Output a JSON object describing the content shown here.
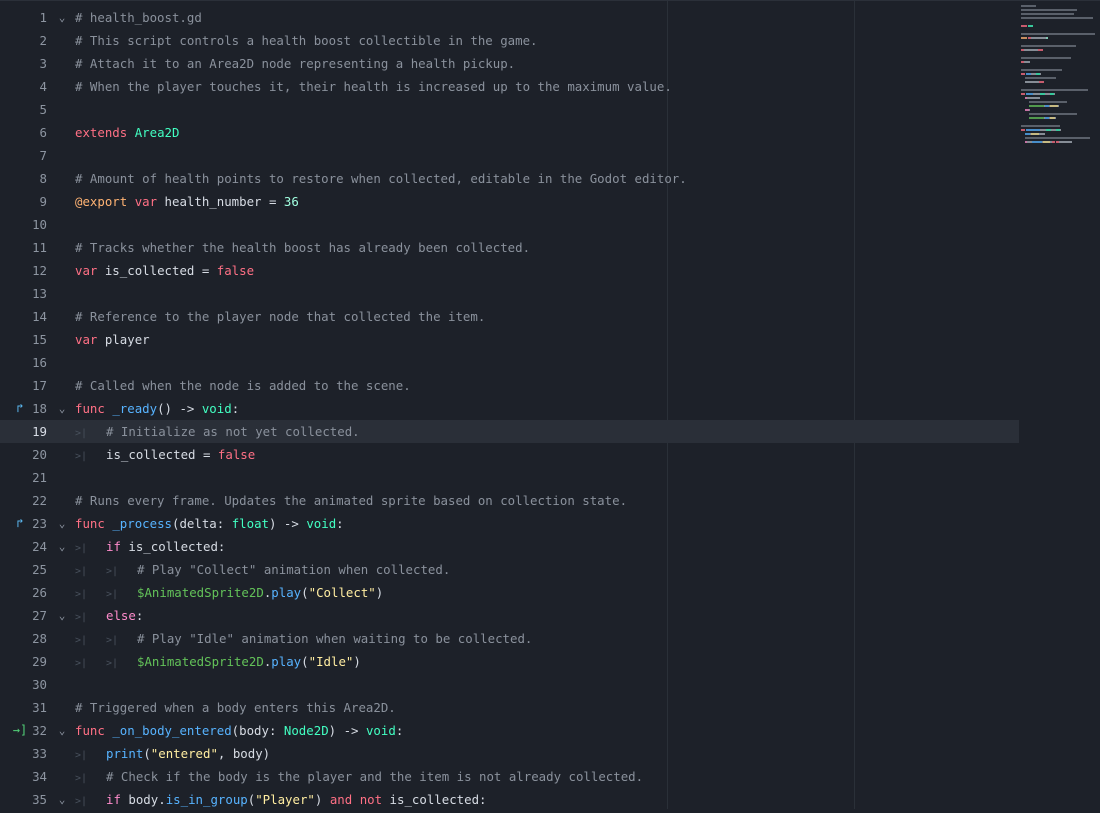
{
  "editor": {
    "current_line": 19,
    "colors": {
      "background": "#1d2129",
      "comment": "#8a919c",
      "keyword": "#ff7085",
      "type": "#42ffc2",
      "function": "#57b3ff",
      "string": "#ffeda1",
      "number": "#a1ffe0",
      "annotation": "#ffb373",
      "node_path": "#63c259"
    },
    "lines": [
      {
        "n": "1",
        "fold": true,
        "tokens": [
          {
            "t": "# health_boost.gd",
            "c": "cm"
          }
        ]
      },
      {
        "n": "2",
        "tokens": [
          {
            "t": "# This script controls a health boost collectible in the game.",
            "c": "cm"
          }
        ]
      },
      {
        "n": "3",
        "tokens": [
          {
            "t": "# Attach it to an Area2D node representing a health pickup.",
            "c": "cm"
          }
        ]
      },
      {
        "n": "4",
        "tokens": [
          {
            "t": "# When the player touches it, their health is increased up to the maximum value.",
            "c": "cm"
          }
        ]
      },
      {
        "n": "5",
        "tokens": []
      },
      {
        "n": "6",
        "tokens": [
          {
            "t": "extends",
            "c": "kw"
          },
          {
            "t": " "
          },
          {
            "t": "Area2D",
            "c": "ty"
          }
        ]
      },
      {
        "n": "7",
        "tokens": []
      },
      {
        "n": "8",
        "tokens": [
          {
            "t": "# Amount of health points to restore when collected, editable in the Godot editor.",
            "c": "cm"
          }
        ]
      },
      {
        "n": "9",
        "tokens": [
          {
            "t": "@export",
            "c": "ann"
          },
          {
            "t": " "
          },
          {
            "t": "var",
            "c": "kw"
          },
          {
            "t": " health_number = "
          },
          {
            "t": "36",
            "c": "num"
          }
        ]
      },
      {
        "n": "10",
        "tokens": []
      },
      {
        "n": "11",
        "tokens": [
          {
            "t": "# Tracks whether the health boost has already been collected.",
            "c": "cm"
          }
        ]
      },
      {
        "n": "12",
        "tokens": [
          {
            "t": "var",
            "c": "kw"
          },
          {
            "t": " is_collected = "
          },
          {
            "t": "false",
            "c": "kw"
          }
        ]
      },
      {
        "n": "13",
        "tokens": []
      },
      {
        "n": "14",
        "tokens": [
          {
            "t": "# Reference to the player node that collected the item.",
            "c": "cm"
          }
        ]
      },
      {
        "n": "15",
        "tokens": [
          {
            "t": "var",
            "c": "kw"
          },
          {
            "t": " player"
          }
        ]
      },
      {
        "n": "16",
        "tokens": []
      },
      {
        "n": "17",
        "tokens": [
          {
            "t": "# Called when the node is added to the scene.",
            "c": "cm"
          }
        ]
      },
      {
        "n": "18",
        "fold": true,
        "icon": "override",
        "tokens": [
          {
            "t": "func",
            "c": "kw"
          },
          {
            "t": " "
          },
          {
            "t": "_ready",
            "c": "fn"
          },
          {
            "t": "() -> "
          },
          {
            "t": "void",
            "c": "ty"
          },
          {
            "t": ":"
          }
        ]
      },
      {
        "n": "19",
        "indent": 1,
        "tokens": [
          {
            "t": "# Initialize as not yet collected.",
            "c": "cm"
          }
        ]
      },
      {
        "n": "20",
        "indent": 1,
        "tokens": [
          {
            "t": "is_collected = "
          },
          {
            "t": "false",
            "c": "kw"
          }
        ]
      },
      {
        "n": "21",
        "tokens": []
      },
      {
        "n": "22",
        "tokens": [
          {
            "t": "# Runs every frame. Updates the animated sprite based on collection state.",
            "c": "cm"
          }
        ]
      },
      {
        "n": "23",
        "fold": true,
        "icon": "override",
        "tokens": [
          {
            "t": "func",
            "c": "kw"
          },
          {
            "t": " "
          },
          {
            "t": "_process",
            "c": "fn"
          },
          {
            "t": "(delta: "
          },
          {
            "t": "float",
            "c": "ty"
          },
          {
            "t": ") -> "
          },
          {
            "t": "void",
            "c": "ty"
          },
          {
            "t": ":"
          }
        ]
      },
      {
        "n": "24",
        "fold": true,
        "indent": 1,
        "tokens": [
          {
            "t": "if",
            "c": "dk"
          },
          {
            "t": " is_collected:"
          }
        ]
      },
      {
        "n": "25",
        "indent": 2,
        "tokens": [
          {
            "t": "# Play \"Collect\" animation when collected.",
            "c": "cm"
          }
        ]
      },
      {
        "n": "26",
        "indent": 2,
        "tokens": [
          {
            "t": "$AnimatedSprite2D",
            "c": "node"
          },
          {
            "t": "."
          },
          {
            "t": "play",
            "c": "fn"
          },
          {
            "t": "("
          },
          {
            "t": "\"Collect\"",
            "c": "str"
          },
          {
            "t": ")"
          }
        ]
      },
      {
        "n": "27",
        "fold": true,
        "indent": 1,
        "tokens": [
          {
            "t": "else",
            "c": "dk"
          },
          {
            "t": ":"
          }
        ]
      },
      {
        "n": "28",
        "indent": 2,
        "tokens": [
          {
            "t": "# Play \"Idle\" animation when waiting to be collected.",
            "c": "cm"
          }
        ]
      },
      {
        "n": "29",
        "indent": 2,
        "tokens": [
          {
            "t": "$AnimatedSprite2D",
            "c": "node"
          },
          {
            "t": "."
          },
          {
            "t": "play",
            "c": "fn"
          },
          {
            "t": "("
          },
          {
            "t": "\"Idle\"",
            "c": "str"
          },
          {
            "t": ")"
          }
        ]
      },
      {
        "n": "30",
        "tokens": []
      },
      {
        "n": "31",
        "tokens": [
          {
            "t": "# Triggered when a body enters this Area2D.",
            "c": "cm"
          }
        ]
      },
      {
        "n": "32",
        "fold": true,
        "icon": "signal",
        "tokens": [
          {
            "t": "func",
            "c": "kw"
          },
          {
            "t": " "
          },
          {
            "t": "_on_body_entered",
            "c": "fn"
          },
          {
            "t": "(body: "
          },
          {
            "t": "Node2D",
            "c": "ty"
          },
          {
            "t": ") -> "
          },
          {
            "t": "void",
            "c": "ty"
          },
          {
            "t": ":"
          }
        ]
      },
      {
        "n": "33",
        "indent": 1,
        "tokens": [
          {
            "t": "print",
            "c": "fn"
          },
          {
            "t": "("
          },
          {
            "t": "\"entered\"",
            "c": "str"
          },
          {
            "t": ", body)"
          }
        ]
      },
      {
        "n": "34",
        "indent": 1,
        "tokens": [
          {
            "t": "# Check if the body is the player and the item is not already collected.",
            "c": "cm"
          }
        ]
      },
      {
        "n": "35",
        "fold": true,
        "indent": 1,
        "tokens": [
          {
            "t": "if",
            "c": "dk"
          },
          {
            "t": " body."
          },
          {
            "t": "is_in_group",
            "c": "fn"
          },
          {
            "t": "("
          },
          {
            "t": "\"Player\"",
            "c": "str"
          },
          {
            "t": ") "
          },
          {
            "t": "and",
            "c": "kw"
          },
          {
            "t": " "
          },
          {
            "t": "not",
            "c": "kw"
          },
          {
            "t": " is_collected:"
          }
        ]
      }
    ]
  }
}
